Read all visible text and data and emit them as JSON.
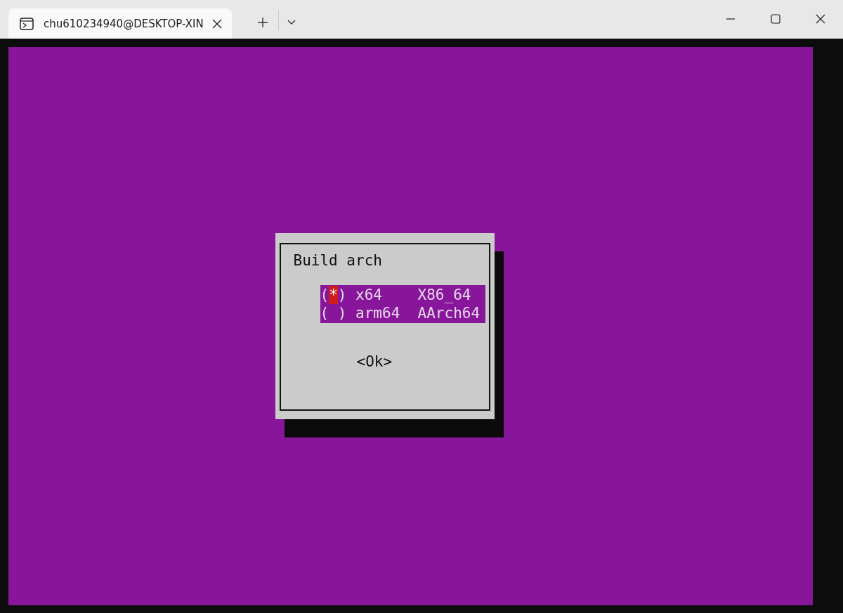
{
  "window": {
    "tab_title": "chu610234940@DESKTOP-XIN"
  },
  "dialog": {
    "title": "Build arch",
    "options": [
      {
        "radio_open": "(",
        "radio_mark": "*",
        "radio_close": ")",
        "label": "x64",
        "description": "X86_64",
        "selected": true
      },
      {
        "radio_open": "(",
        "radio_close": ")",
        "label": "arm64",
        "description": "AArch64",
        "selected": false
      }
    ],
    "button": "<Ok>"
  }
}
